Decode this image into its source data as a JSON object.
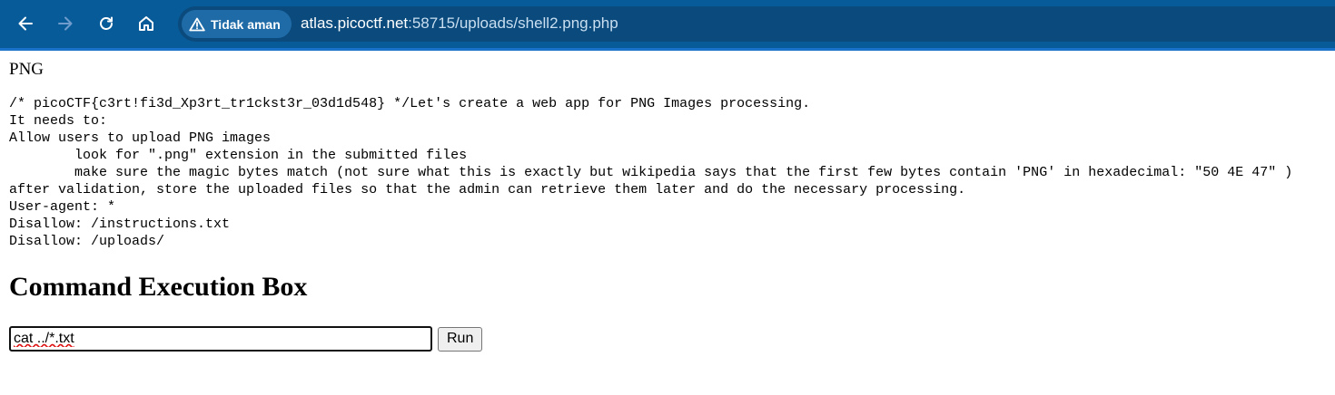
{
  "browser": {
    "security_label": "Tidak aman",
    "url_host": "atlas.picoctf.net",
    "url_rest": ":58715/uploads/shell2.png.php",
    "icons": {
      "back": "arrow-left-icon",
      "forward": "arrow-right-icon",
      "reload": "reload-icon",
      "home": "home-icon",
      "security": "warning-triangle-icon"
    },
    "colors": {
      "toolbar": "#075b99",
      "omnibox": "#0b4a7c",
      "chip": "#1e6ba8"
    }
  },
  "page": {
    "head_text": "PNG",
    "pre_lines": [
      "/* picoCTF{c3rt!fi3d_Xp3rt_tr1ckst3r_03d1d548} */Let's create a web app for PNG Images processing.",
      "It needs to:",
      "Allow users to upload PNG images",
      "\tlook for \".png\" extension in the submitted files",
      "\tmake sure the magic bytes match (not sure what this is exactly but wikipedia says that the first few bytes contain 'PNG' in hexadecimal: \"50 4E 47\" )",
      "after validation, store the uploaded files so that the admin can retrieve them later and do the necessary processing.",
      "User-agent: *",
      "Disallow: /instructions.txt",
      "Disallow: /uploads/"
    ],
    "heading": "Command Execution Box",
    "command_value": "cat ../*.txt",
    "run_label": "Run"
  }
}
